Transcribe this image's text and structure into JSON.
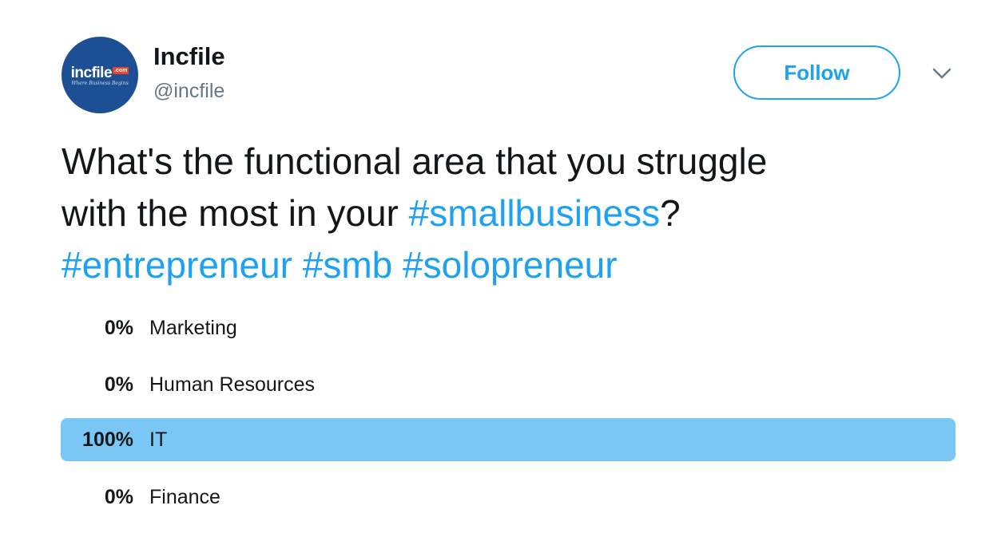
{
  "account": {
    "display_name": "Incfile",
    "handle": "@incfile",
    "avatar_logo": "incfile",
    "avatar_logo_suffix": ".com",
    "avatar_tagline": "Where Business Begins"
  },
  "actions": {
    "follow_label": "Follow",
    "more_icon": "chevron-down-icon"
  },
  "tweet": {
    "line1": "What's the functional area that you struggle",
    "line2_text": "with the most in your ",
    "line2_hashtag": "#smallbusiness",
    "line2_end": "?",
    "hashtags_line3": [
      "#entrepreneur",
      "#smb",
      "#solopreneur"
    ]
  },
  "poll": {
    "choices": [
      {
        "percent": "0%",
        "label": "Marketing",
        "fraction": 0.0
      },
      {
        "percent": "0%",
        "label": "Human Resources",
        "fraction": 0.0
      },
      {
        "percent": "100%",
        "label": "IT",
        "fraction": 1.0
      },
      {
        "percent": "0%",
        "label": "Finance",
        "fraction": 0.0
      }
    ]
  },
  "colors": {
    "brand_blue": "#1da1f2",
    "winning_bar": "#7ac7f5",
    "avatar_bg": "#1c4f93",
    "logo_accent": "#e8452c",
    "text_primary": "#14171a",
    "text_secondary": "#657786"
  }
}
